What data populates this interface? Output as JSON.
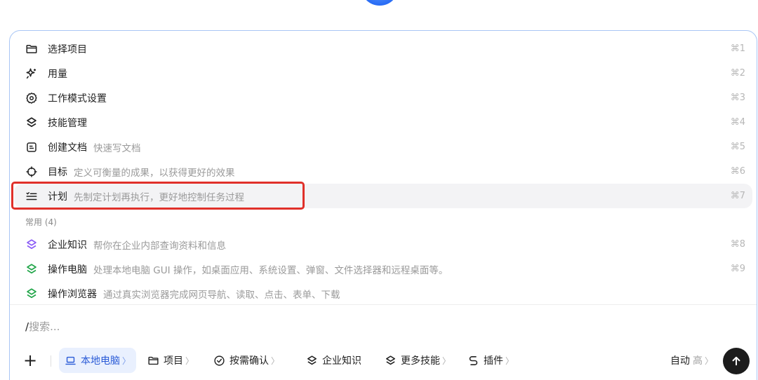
{
  "menu": {
    "items": [
      {
        "label": "选择项目",
        "desc": "",
        "shortcut": "⌘1",
        "icon": "folder-icon"
      },
      {
        "label": "用量",
        "desc": "",
        "shortcut": "⌘2",
        "icon": "sparkle-icon"
      },
      {
        "label": "工作模式设置",
        "desc": "",
        "shortcut": "⌘3",
        "icon": "gear-icon"
      },
      {
        "label": "技能管理",
        "desc": "",
        "shortcut": "⌘4",
        "icon": "layers-icon"
      },
      {
        "label": "创建文档",
        "desc": "快速写文档",
        "shortcut": "⌘5",
        "icon": "document-icon"
      },
      {
        "label": "目标",
        "desc": "定义可衡量的成果，以获得更好的效果",
        "shortcut": "⌘6",
        "icon": "crosshair-icon"
      },
      {
        "label": "计划",
        "desc": "先制定计划再执行，更好地控制任务过程",
        "shortcut": "⌘7",
        "icon": "checklist-icon"
      }
    ],
    "section_label": "常用 (4)",
    "frequent": [
      {
        "label": "企业知识",
        "desc": "帮你在企业内部查询资料和信息",
        "shortcut": "⌘8",
        "icon": "layers-icon",
        "color": "#8b5cf6"
      },
      {
        "label": "操作电脑",
        "desc": "处理本地电脑 GUI 操作，如桌面应用、系统设置、弹窗、文件选择器和远程桌面等。",
        "shortcut": "⌘9",
        "icon": "layers-icon",
        "color": "#22a64a"
      },
      {
        "label": "操作浏览器",
        "desc": "通过真实浏览器完成网页导航、读取、点击、表单、下载",
        "shortcut": "",
        "icon": "layers-icon",
        "color": "#22a64a"
      }
    ]
  },
  "search": {
    "prefix": "/",
    "placeholder": "搜索..."
  },
  "toolbar": {
    "add": "+",
    "local_computer": "本地电脑",
    "project": "项目",
    "confirm": "按需确认",
    "enterprise": "企业知识",
    "more_skills": "更多技能",
    "plugins": "插件",
    "auto": "自动",
    "level": "高",
    "chevron": "〉"
  },
  "colors": {
    "accent": "#2a5bd7",
    "highlight_box": "#e0302a"
  }
}
